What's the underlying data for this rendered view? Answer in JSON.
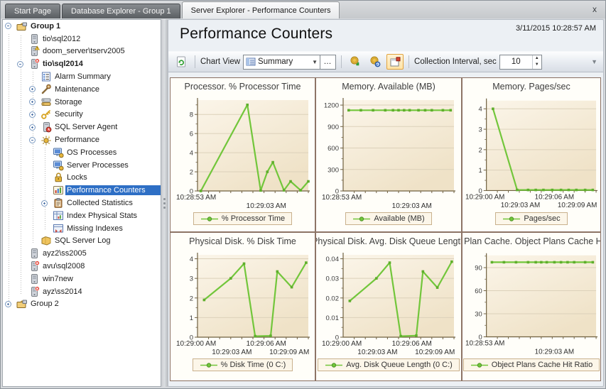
{
  "tabs": [
    {
      "label": "Start Page",
      "active": false
    },
    {
      "label": "Database Explorer - Group 1",
      "active": false
    },
    {
      "label": "Server Explorer - Performance Counters",
      "active": true
    }
  ],
  "tabbar": {
    "close_label": "x"
  },
  "header": {
    "title": "Performance Counters",
    "timestamp": "3/11/2015 10:28:57 AM"
  },
  "toolbar": {
    "refresh_icon": "refresh-icon",
    "chart_view_label": "Chart View",
    "view_icon": "summary-view-icon",
    "view_value": "Summary",
    "dropdown_glyph": "▼",
    "more_label": "…",
    "coins_down_icon": "coins-down-icon",
    "coins_cycle_icon": "coins-cycle-icon",
    "detach_window_icon": "detach-window-icon",
    "interval_label": "Collection Interval, sec",
    "interval_value": "10",
    "spin_up_glyph": "▲",
    "spin_down_glyph": "▼",
    "overflow_glyph": "▼"
  },
  "sidebar": {
    "items": [
      {
        "label": "Group 1",
        "level": 0,
        "icon": "group-folder",
        "expander": "minus",
        "bold": true,
        "selected": false,
        "overlay": "none"
      },
      {
        "label": "tio\\sql2012",
        "level": 1,
        "icon": "server",
        "expander": "none",
        "bold": false,
        "selected": false,
        "overlay": "none"
      },
      {
        "label": "doom_server\\tserv2005",
        "level": 1,
        "icon": "server",
        "expander": "none",
        "bold": false,
        "selected": false,
        "overlay": "warn"
      },
      {
        "label": "tio\\sql2014",
        "level": 1,
        "icon": "server",
        "expander": "minus",
        "bold": true,
        "selected": false,
        "overlay": "err"
      },
      {
        "label": "Alarm Summary",
        "level": 2,
        "icon": "alarm-summary",
        "expander": "none",
        "bold": false,
        "selected": false,
        "overlay": "none"
      },
      {
        "label": "Maintenance",
        "level": 2,
        "icon": "maintenance",
        "expander": "plus",
        "bold": false,
        "selected": false,
        "overlay": "none"
      },
      {
        "label": "Storage",
        "level": 2,
        "icon": "storage",
        "expander": "plus",
        "bold": false,
        "selected": false,
        "overlay": "none"
      },
      {
        "label": "Security",
        "level": 2,
        "icon": "security",
        "expander": "plus",
        "bold": false,
        "selected": false,
        "overlay": "none"
      },
      {
        "label": "SQL Server Agent",
        "level": 2,
        "icon": "agent",
        "expander": "plus",
        "bold": false,
        "selected": false,
        "overlay": "none"
      },
      {
        "label": "Performance",
        "level": 2,
        "icon": "performance",
        "expander": "minus",
        "bold": false,
        "selected": false,
        "overlay": "none"
      },
      {
        "label": "OS Processes",
        "level": 3,
        "icon": "processes",
        "expander": "none",
        "bold": false,
        "selected": false,
        "overlay": "none"
      },
      {
        "label": "Server Processes",
        "level": 3,
        "icon": "processes",
        "expander": "none",
        "bold": false,
        "selected": false,
        "overlay": "none"
      },
      {
        "label": "Locks",
        "level": 3,
        "icon": "locks",
        "expander": "none",
        "bold": false,
        "selected": false,
        "overlay": "none"
      },
      {
        "label": "Performance Counters",
        "level": 3,
        "icon": "perf-counters",
        "expander": "none",
        "bold": false,
        "selected": true,
        "overlay": "none"
      },
      {
        "label": "Collected Statistics",
        "level": 3,
        "icon": "collected-stats",
        "expander": "plus",
        "bold": false,
        "selected": false,
        "overlay": "none"
      },
      {
        "label": "Index Physical Stats",
        "level": 3,
        "icon": "index-stats",
        "expander": "none",
        "bold": false,
        "selected": false,
        "overlay": "none"
      },
      {
        "label": "Missing Indexes",
        "level": 3,
        "icon": "missing-indexes",
        "expander": "none",
        "bold": false,
        "selected": false,
        "overlay": "none"
      },
      {
        "label": "SQL Server Log",
        "level": 2,
        "icon": "sql-log",
        "expander": "none",
        "bold": false,
        "selected": false,
        "overlay": "none"
      },
      {
        "label": "ayz2\\ss2005",
        "level": 1,
        "icon": "server",
        "expander": "none",
        "bold": false,
        "selected": false,
        "overlay": "none"
      },
      {
        "label": "avu\\sql2008",
        "level": 1,
        "icon": "server",
        "expander": "none",
        "bold": false,
        "selected": false,
        "overlay": "err"
      },
      {
        "label": "win7new",
        "level": 1,
        "icon": "server",
        "expander": "none",
        "bold": false,
        "selected": false,
        "overlay": "none"
      },
      {
        "label": "ayz\\ss2014",
        "level": 1,
        "icon": "server",
        "expander": "none",
        "bold": false,
        "selected": false,
        "overlay": "err"
      },
      {
        "label": "Group 2",
        "level": 0,
        "icon": "group-folder",
        "expander": "plus",
        "bold": false,
        "selected": false,
        "overlay": "none"
      }
    ]
  },
  "chart_colors": {
    "line": "#72c63b",
    "marker": "#5fae2c",
    "plot_bg_top": "#fbf5e9",
    "plot_bg_bottom": "#efe2c7",
    "grid": "#dcd1ba",
    "axis": "#6f6040"
  },
  "chart_data": [
    {
      "type": "line",
      "title": "Processor. % Processor Time",
      "legend": "% Processor Time",
      "ylim": [
        0,
        9.5
      ],
      "yticks": [
        0,
        2,
        4,
        6,
        8
      ],
      "grid": true,
      "legend_position": "bottom",
      "x_unit": "time",
      "points": [
        [
          0.03,
          0
        ],
        [
          0.45,
          9
        ],
        [
          0.57,
          0.05
        ],
        [
          0.63,
          2
        ],
        [
          0.68,
          3
        ],
        [
          0.78,
          0.07
        ],
        [
          0.84,
          1
        ],
        [
          0.93,
          0.07
        ],
        [
          1,
          1
        ]
      ],
      "xlabels": [
        {
          "text": "10:28:53 AM",
          "x": 0,
          "row": 0,
          "anchor": "start"
        },
        {
          "text": "10:29:03 AM",
          "x": 0.62,
          "row": 1,
          "anchor": "middle"
        }
      ]
    },
    {
      "type": "line",
      "title": "Memory. Available (MB)",
      "legend": "Available (MB)",
      "ylim": [
        0,
        1270
      ],
      "yticks": [
        0,
        300,
        600,
        900,
        1200
      ],
      "grid": true,
      "legend_position": "bottom",
      "x_unit": "time",
      "points": [
        [
          0.05,
          1128
        ],
        [
          0.16,
          1128
        ],
        [
          0.27,
          1128
        ],
        [
          0.38,
          1128
        ],
        [
          0.45,
          1128
        ],
        [
          0.5,
          1128
        ],
        [
          0.55,
          1128
        ],
        [
          0.6,
          1128
        ],
        [
          0.68,
          1128
        ],
        [
          0.74,
          1128
        ],
        [
          0.8,
          1128
        ],
        [
          0.9,
          1128
        ],
        [
          0.97,
          1128
        ]
      ],
      "xlabels": [
        {
          "text": "10:28:53 AM",
          "x": 0,
          "row": 0,
          "anchor": "start"
        },
        {
          "text": "10:29:03 AM",
          "x": 0.62,
          "row": 1,
          "anchor": "middle"
        }
      ]
    },
    {
      "type": "line",
      "title": "Memory. Pages/sec",
      "legend": "Pages/sec",
      "ylim": [
        0,
        4.4
      ],
      "yticks": [
        0,
        1,
        2,
        3,
        4
      ],
      "grid": true,
      "legend_position": "bottom",
      "x_unit": "time",
      "points": [
        [
          0.06,
          4
        ],
        [
          0.28,
          0.03
        ],
        [
          0.38,
          0.03
        ],
        [
          0.45,
          0.03
        ],
        [
          0.52,
          0.03
        ],
        [
          0.6,
          0.03
        ],
        [
          0.68,
          0.03
        ],
        [
          0.75,
          0.03
        ],
        [
          0.82,
          0.03
        ],
        [
          0.9,
          0.03
        ],
        [
          0.97,
          0.03
        ]
      ],
      "xlabels": [
        {
          "text": "10:29:00 AM",
          "x": 0,
          "row": 0,
          "anchor": "start"
        },
        {
          "text": "10:29:06 AM",
          "x": 0.62,
          "row": 0,
          "anchor": "middle"
        },
        {
          "text": "10:29:03 AM",
          "x": 0.31,
          "row": 1,
          "anchor": "middle"
        },
        {
          "text": "10:29:09 AM",
          "x": 0.97,
          "row": 1,
          "anchor": "end"
        }
      ]
    },
    {
      "type": "line",
      "title": "Physical Disk. % Disk Time",
      "legend": "% Disk Time (0 C:)",
      "ylim": [
        0,
        4.2
      ],
      "yticks": [
        0,
        1,
        2,
        3,
        4
      ],
      "grid": true,
      "legend_position": "bottom",
      "x_unit": "time",
      "points": [
        [
          0.06,
          1.9
        ],
        [
          0.3,
          3.0
        ],
        [
          0.42,
          3.75
        ],
        [
          0.52,
          0.05
        ],
        [
          0.66,
          0.07
        ],
        [
          0.72,
          3.35
        ],
        [
          0.85,
          2.55
        ],
        [
          0.98,
          3.8
        ]
      ],
      "xlabels": [
        {
          "text": "10:29:00 AM",
          "x": 0,
          "row": 0,
          "anchor": "start"
        },
        {
          "text": "10:29:06 AM",
          "x": 0.62,
          "row": 0,
          "anchor": "middle"
        },
        {
          "text": "10:29:03 AM",
          "x": 0.31,
          "row": 1,
          "anchor": "middle"
        },
        {
          "text": "10:29:09 AM",
          "x": 0.97,
          "row": 1,
          "anchor": "end"
        }
      ]
    },
    {
      "type": "line",
      "title": "Physical Disk. Avg. Disk Queue Length",
      "legend": "Avg. Disk Queue Length (0 C:)",
      "ylim": [
        0,
        0.042
      ],
      "yticks": [
        0,
        0.01,
        0.02,
        0.03,
        0.04
      ],
      "grid": true,
      "legend_position": "bottom",
      "x_unit": "time",
      "points": [
        [
          0.06,
          0.0185
        ],
        [
          0.3,
          0.03
        ],
        [
          0.42,
          0.038
        ],
        [
          0.52,
          0.0005
        ],
        [
          0.66,
          0.0008
        ],
        [
          0.72,
          0.0335
        ],
        [
          0.85,
          0.0253
        ],
        [
          0.98,
          0.0385
        ]
      ],
      "xlabels": [
        {
          "text": "10:29:00 AM",
          "x": 0,
          "row": 0,
          "anchor": "start"
        },
        {
          "text": "10:29:06 AM",
          "x": 0.62,
          "row": 0,
          "anchor": "middle"
        },
        {
          "text": "10:29:03 AM",
          "x": 0.31,
          "row": 1,
          "anchor": "middle"
        },
        {
          "text": "10:29:09 AM",
          "x": 0.97,
          "row": 1,
          "anchor": "end"
        }
      ]
    },
    {
      "type": "line",
      "title": "Server: Plan Cache. Object Plans Cache Hit Ratio",
      "legend": "Object Plans Cache Hit Ratio",
      "ylim": [
        0,
        106
      ],
      "yticks": [
        0,
        30,
        60,
        90
      ],
      "grid": true,
      "legend_position": "bottom",
      "x_unit": "time",
      "points": [
        [
          0.05,
          97
        ],
        [
          0.16,
          97
        ],
        [
          0.27,
          97
        ],
        [
          0.38,
          97
        ],
        [
          0.45,
          97
        ],
        [
          0.5,
          97
        ],
        [
          0.55,
          97
        ],
        [
          0.62,
          97
        ],
        [
          0.68,
          97
        ],
        [
          0.74,
          97
        ],
        [
          0.8,
          97
        ],
        [
          0.9,
          97
        ],
        [
          0.97,
          97
        ]
      ],
      "xlabels": [
        {
          "text": "10:28:53 AM",
          "x": 0,
          "row": 0,
          "anchor": "start"
        },
        {
          "text": "10:29:03 AM",
          "x": 0.62,
          "row": 1,
          "anchor": "middle"
        }
      ]
    }
  ]
}
